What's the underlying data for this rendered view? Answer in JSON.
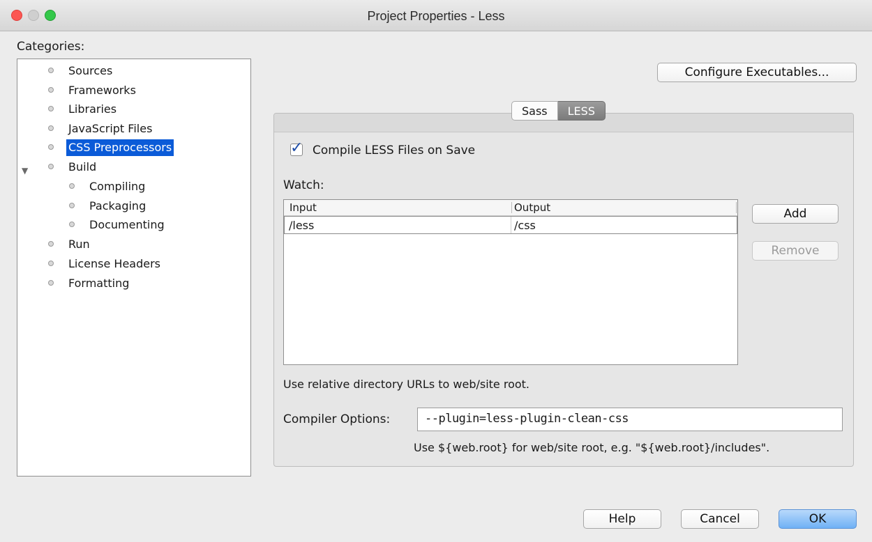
{
  "window": {
    "title": "Project Properties - Less"
  },
  "categories": {
    "label": "Categories:",
    "items": [
      {
        "label": "Sources"
      },
      {
        "label": "Frameworks"
      },
      {
        "label": "Libraries"
      },
      {
        "label": "JavaScript Files"
      },
      {
        "label": "CSS Preprocessors",
        "selected": true
      },
      {
        "label": "Build",
        "expanded": true
      },
      {
        "label": "Compiling"
      },
      {
        "label": "Packaging"
      },
      {
        "label": "Documenting"
      },
      {
        "label": "Run"
      },
      {
        "label": "License Headers"
      },
      {
        "label": "Formatting"
      }
    ]
  },
  "configure_button": "Configure Executables...",
  "tabs": [
    {
      "label": "Sass"
    },
    {
      "label": "LESS",
      "selected": true
    }
  ],
  "compile_checkbox": {
    "label": "Compile LESS Files on Save",
    "checked": true
  },
  "watch": {
    "label": "Watch:",
    "columns": [
      "Input",
      "Output"
    ],
    "rows": [
      {
        "input": "/less",
        "output": "/css"
      }
    ],
    "add_label": "Add",
    "remove_label": "Remove"
  },
  "hint_relative": "Use relative directory URLs to web/site root.",
  "compiler": {
    "label": "Compiler Options:",
    "value": "--plugin=less-plugin-clean-css",
    "hint": "Use ${web.root} for web/site root, e.g. \"${web.root}/includes\"."
  },
  "footer": {
    "help": "Help",
    "cancel": "Cancel",
    "ok": "OK"
  },
  "colors": {
    "selection": "#0b5bd8",
    "ok_button": "#6fb1f5"
  }
}
